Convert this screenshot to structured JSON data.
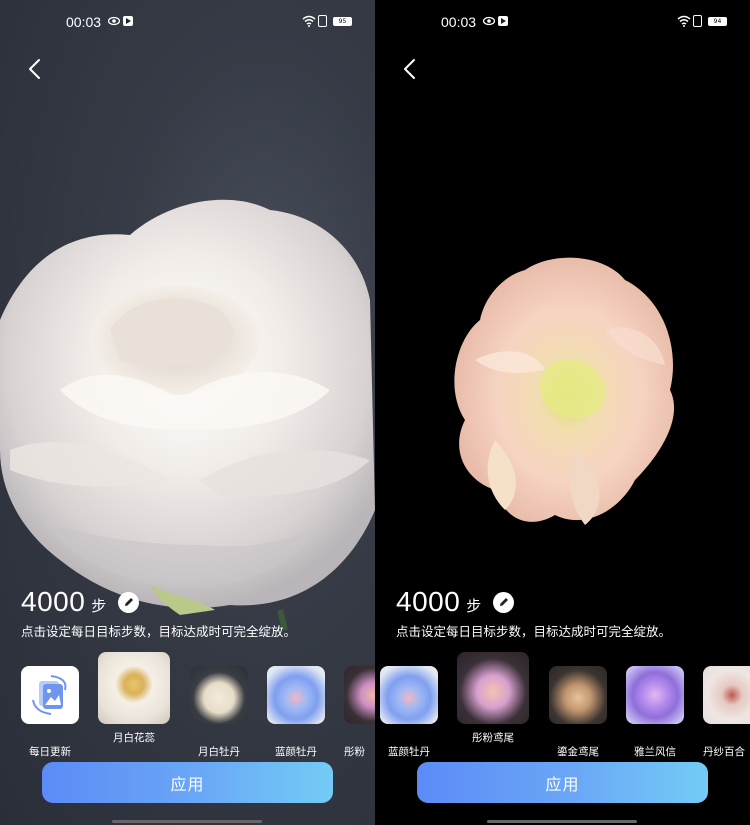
{
  "left": {
    "status": {
      "time": "00:03",
      "battery": "95"
    },
    "steps": {
      "value": "4000",
      "unit": "步"
    },
    "hint": "点击设定每日目标步数，目标达成时可完全绽放。",
    "thumbs": [
      {
        "label": "每日更新",
        "icon": "image-stack-icon"
      },
      {
        "label": "月白花蕊"
      },
      {
        "label": "月白牡丹"
      },
      {
        "label": "蓝颜牡丹"
      },
      {
        "label": "彤粉"
      }
    ],
    "apply_label": "应用"
  },
  "right": {
    "status": {
      "time": "00:03",
      "battery": "94"
    },
    "steps": {
      "value": "4000",
      "unit": "步"
    },
    "hint": "点击设定每日目标步数，目标达成时可完全绽放。",
    "thumbs": [
      {
        "label": "蓝颜牡丹"
      },
      {
        "label": "彤粉鸢尾"
      },
      {
        "label": "鎏金鸢尾"
      },
      {
        "label": "雅兰风信"
      },
      {
        "label": "丹纱百合"
      }
    ],
    "apply_label": "应用"
  },
  "colors": {
    "apply_start": "#5c8bf7",
    "apply_end": "#73ccf5"
  }
}
